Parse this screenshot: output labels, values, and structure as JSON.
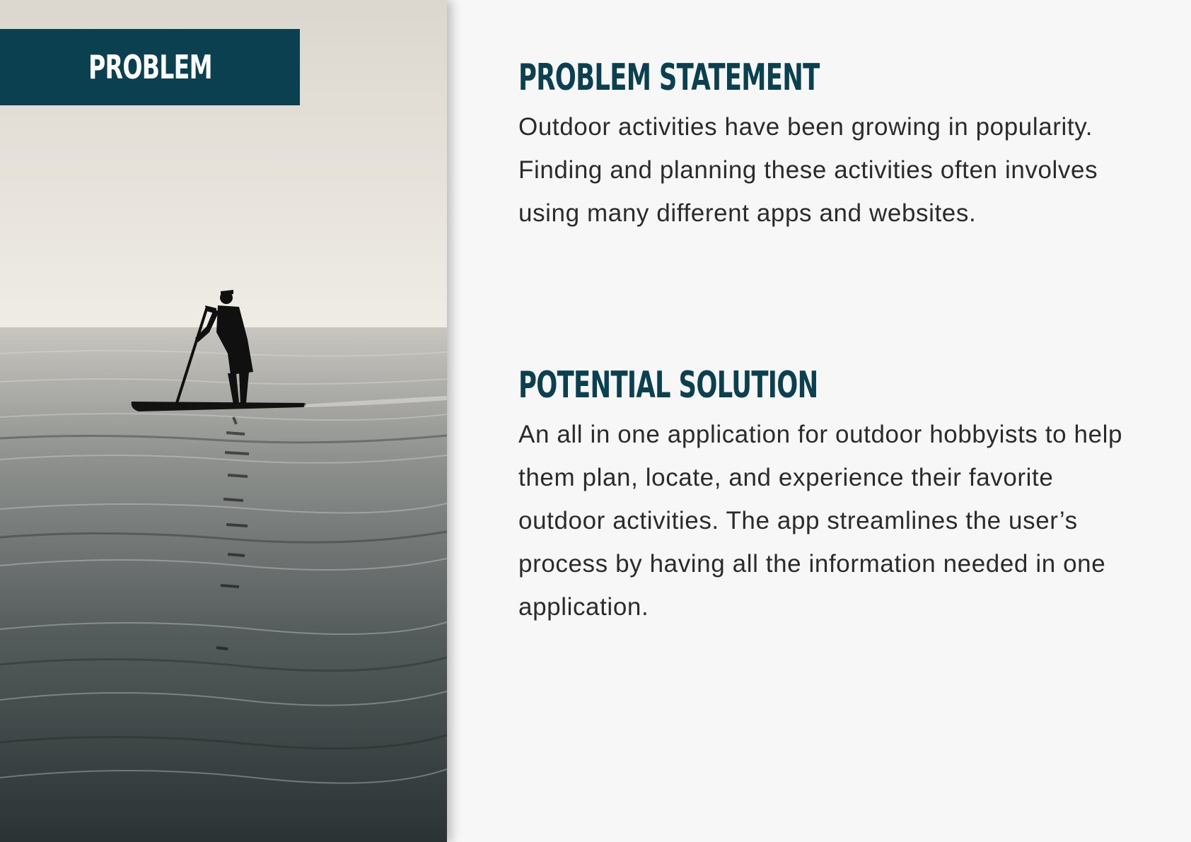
{
  "banner": {
    "label": "PROBLEM",
    "color": "#0a4050"
  },
  "photo": {
    "subject": "paddleboarder-silhouette-on-calm-sea"
  },
  "problem_statement": {
    "heading": "PROBLEM STATEMENT",
    "body": "Outdoor activities have been growing in popularity. Finding and planning these activities often involves using many different apps and websites."
  },
  "potential_solution": {
    "heading": "POTENTIAL SOLUTION",
    "body": "An all in one application for outdoor hobbyists to help them plan, locate, and experience their favorite outdoor activities. The app streamlines the user’s process by having all the information needed in one application."
  },
  "colors": {
    "heading": "#0a4050",
    "body_text": "#2b2b2b",
    "background": "#f7f7f7"
  }
}
